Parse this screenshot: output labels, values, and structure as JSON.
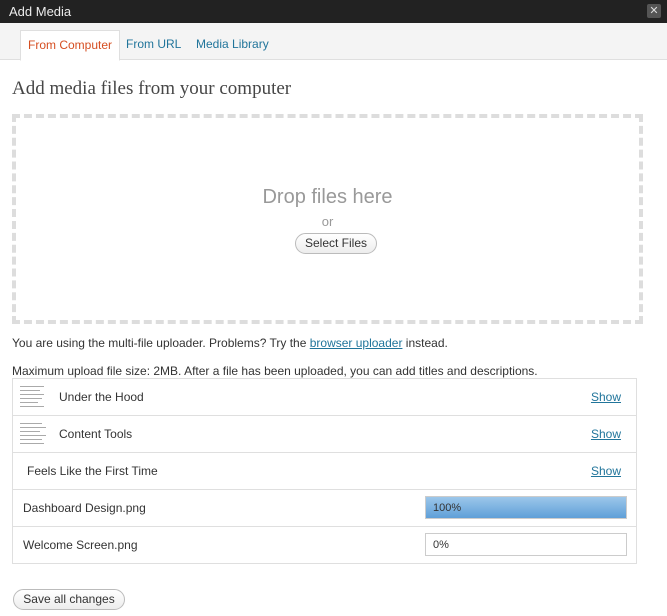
{
  "window": {
    "title": "Add Media",
    "close_glyph": "✕"
  },
  "tabs": [
    {
      "label": "From Computer",
      "active": true
    },
    {
      "label": "From URL",
      "active": false
    },
    {
      "label": "Media Library",
      "active": false
    }
  ],
  "main": {
    "heading": "Add media files from your computer",
    "drop_text": "Drop files here",
    "or_text": "or",
    "select_files_label": "Select Files",
    "info_prefix": "You are using the multi-file uploader. Problems? Try the",
    "info_link": "browser uploader",
    "info_suffix": "instead.",
    "max_upload": "Maximum upload file size: 2MB. After a file has been uploaded, you can add titles and descriptions."
  },
  "files": [
    {
      "name": "Under the Hood",
      "action": "Show",
      "has_thumb": true
    },
    {
      "name": "Content Tools",
      "action": "Show",
      "has_thumb": true
    },
    {
      "name": "Feels Like the First Time",
      "action": "Show",
      "has_thumb": false
    },
    {
      "name": "Dashboard Design.png",
      "progress_label": "100%",
      "progress": 1.0
    },
    {
      "name": "Welcome Screen.png",
      "progress_label": "0%",
      "progress": 0.0
    }
  ],
  "footer": {
    "save_label": "Save all changes"
  },
  "colors": {
    "accent_link": "#21759b",
    "active_tab": "#d54e21",
    "titlebar": "#222222"
  }
}
